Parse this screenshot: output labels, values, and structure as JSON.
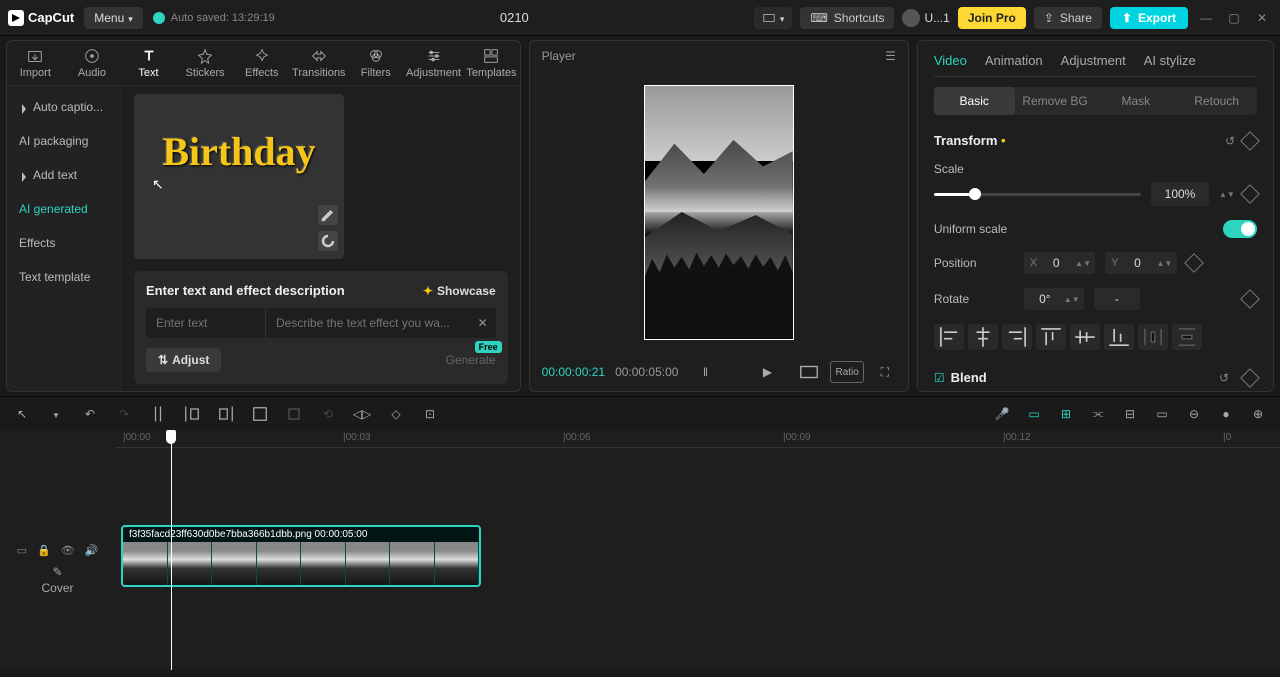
{
  "topbar": {
    "app_name": "CapCut",
    "menu_label": "Menu",
    "autosave_label": "Auto saved: 13:29:19",
    "project_name": "0210",
    "shortcuts_label": "Shortcuts",
    "user_label": "U...1",
    "joinpro_label": "Join Pro",
    "share_label": "Share",
    "export_label": "Export"
  },
  "media_tabs": [
    "Import",
    "Audio",
    "Text",
    "Stickers",
    "Effects",
    "Transitions",
    "Filters",
    "Adjustment",
    "Templates"
  ],
  "text_sidebar": {
    "items": [
      "Auto captio...",
      "AI packaging",
      "Add text",
      "AI generated",
      "Effects",
      "Text template"
    ],
    "active_index": 3
  },
  "text_preview": {
    "word": "Birthday"
  },
  "desc_panel": {
    "title": "Enter text and effect description",
    "showcase": "Showcase",
    "placeholder1": "Enter text",
    "placeholder2": "Describe the text effect you wa...",
    "adjust": "Adjust",
    "generate": "Generate",
    "badge": "Free"
  },
  "player": {
    "title": "Player",
    "current": "00:00:00:21",
    "duration": "00:00:05:00",
    "ratio_label": "Ratio"
  },
  "inspector": {
    "tabs": [
      "Video",
      "Animation",
      "Adjustment",
      "AI stylize"
    ],
    "active_tab": 0,
    "subtabs": [
      "Basic",
      "Remove BG",
      "Mask",
      "Retouch"
    ],
    "active_subtab": 0,
    "transform_title": "Transform",
    "scale_label": "Scale",
    "scale_value": "100%",
    "uniform_label": "Uniform scale",
    "position_label": "Position",
    "pos_x_label": "X",
    "pos_x_val": "0",
    "pos_y_label": "Y",
    "pos_y_val": "0",
    "rotate_label": "Rotate",
    "rotate_val": "0°",
    "rotate_mirror": "-",
    "blend_title": "Blend"
  },
  "timeline": {
    "ticks": [
      {
        "label": "|00:00",
        "pos": 8
      },
      {
        "label": "|00:03",
        "pos": 228
      },
      {
        "label": "|00:06",
        "pos": 448
      },
      {
        "label": "|00:09",
        "pos": 668
      },
      {
        "label": "|00:12",
        "pos": 888
      },
      {
        "label": "|0",
        "pos": 1108
      }
    ],
    "clip_label": "f3f35facd23ff630d0be7bba366b1dbb.png   00:00:05:00",
    "cover_label": "Cover"
  }
}
